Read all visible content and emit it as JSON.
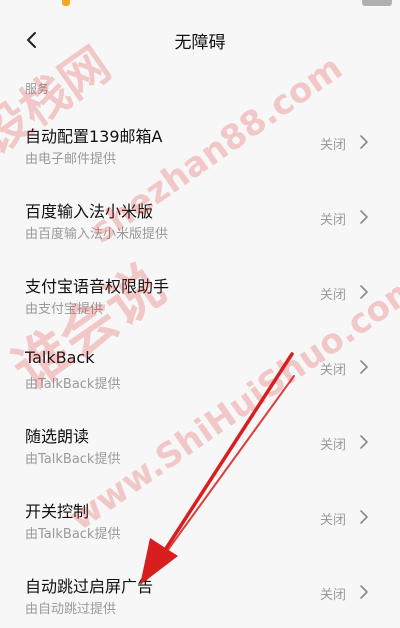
{
  "header": {
    "title": "无障碍"
  },
  "section": {
    "label": "服务"
  },
  "services": [
    {
      "title": "自动配置139邮箱A",
      "provider": "由电子邮件提供",
      "status": "关闭"
    },
    {
      "title": "百度输入法小米版",
      "provider": "由百度输入法小米版提供",
      "status": "关闭"
    },
    {
      "title": "支付宝语音权限助手",
      "provider": "由支付宝提供",
      "status": "关闭"
    },
    {
      "title": "TalkBack",
      "provider": "由TalkBack提供",
      "status": "关闭"
    },
    {
      "title": "随选朗读",
      "provider": "由TalkBack提供",
      "status": "关闭"
    },
    {
      "title": "开关控制",
      "provider": "由TalkBack提供",
      "status": "关闭"
    },
    {
      "title": "自动跳过启屏广告",
      "provider": "由自动跳过提供",
      "status": "关闭"
    }
  ],
  "watermark": {
    "lines": [
      "设栈网",
      "shezhan88.com",
      "谁会说",
      "www.ShiHuiShuo.com"
    ],
    "color": "#e02020"
  },
  "annotation": {
    "arrow_color": "#d81e1e"
  },
  "icons": {
    "back": "back-arrow-icon",
    "chevron": "chevron-right-icon"
  }
}
